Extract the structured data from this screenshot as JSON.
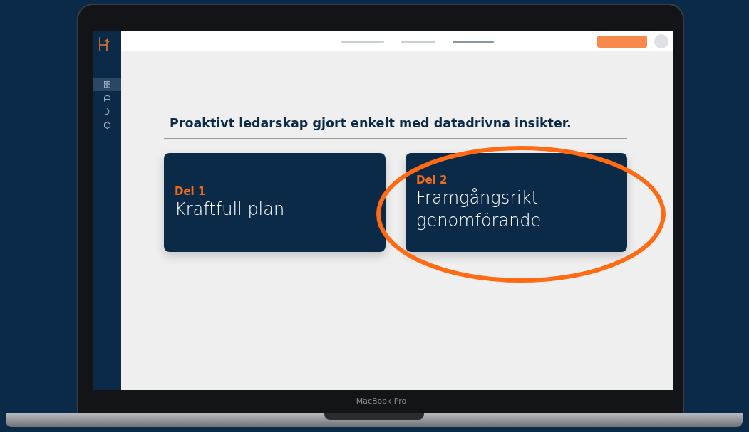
{
  "device": {
    "label": "MacBook Pro"
  },
  "sidebar": {
    "items": [
      {
        "selected": true
      },
      {
        "selected": false
      },
      {
        "selected": false
      },
      {
        "selected": false
      }
    ]
  },
  "nav_tabs": [
    {
      "selected": false
    },
    {
      "selected": false
    },
    {
      "selected": true
    }
  ],
  "heading": "Proaktivt ledarskap gjort enkelt med datadrivna insikter.",
  "cards": [
    {
      "label": "Del 1",
      "title": "Kraftfull plan",
      "highlighted": false
    },
    {
      "label": "Del 2",
      "title": "Framgångsrikt genomförande",
      "highlighted": true
    }
  ]
}
